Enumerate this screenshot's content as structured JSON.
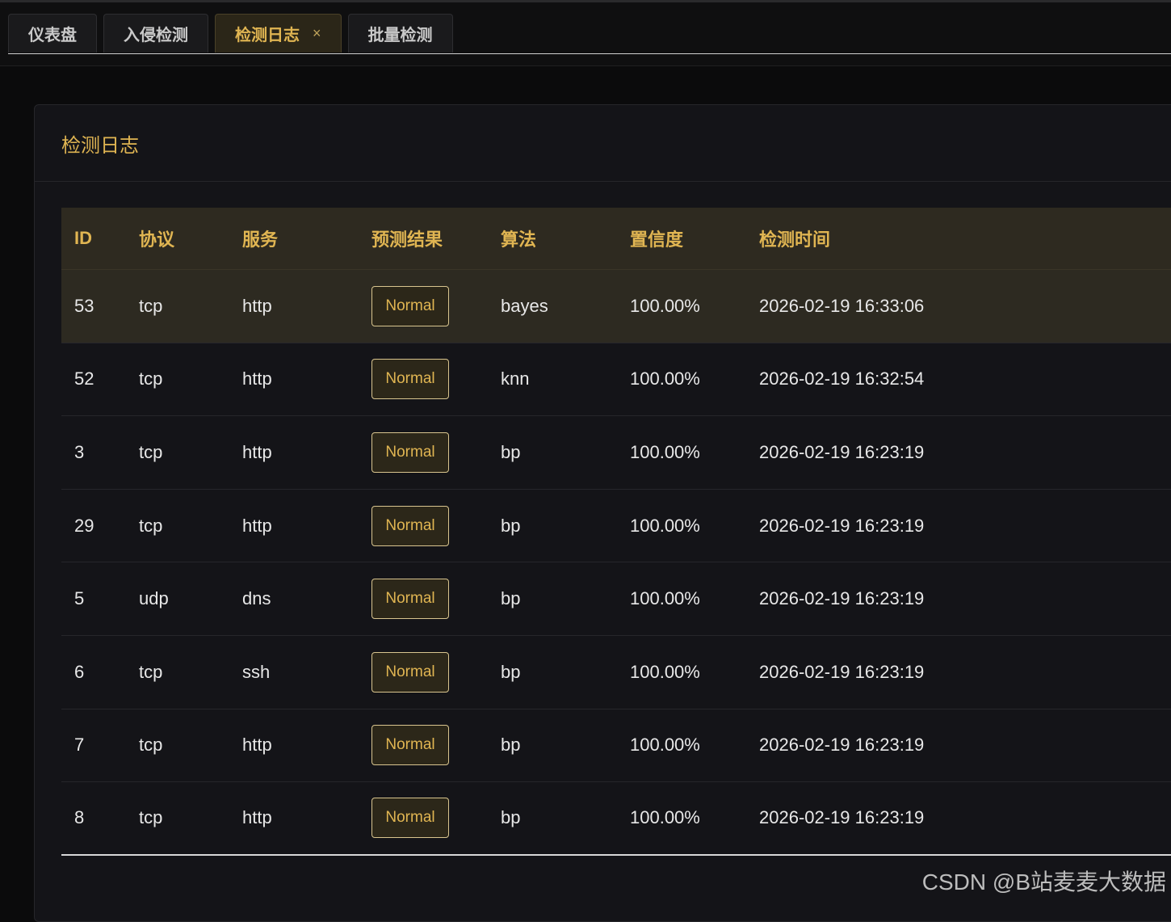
{
  "tabs": [
    {
      "label": "仪表盘",
      "active": false
    },
    {
      "label": "入侵检测",
      "active": false
    },
    {
      "label": "检测日志",
      "active": true,
      "close": "×"
    },
    {
      "label": "批量检测",
      "active": false
    }
  ],
  "card": {
    "title": "检测日志"
  },
  "table": {
    "columns": [
      "ID",
      "协议",
      "服务",
      "预测结果",
      "算法",
      "置信度",
      "检测时间"
    ],
    "rows": [
      [
        "53",
        "tcp",
        "http",
        "Normal",
        "bayes",
        "100.00%",
        "2026-02-19 16:33:06"
      ],
      [
        "52",
        "tcp",
        "http",
        "Normal",
        "knn",
        "100.00%",
        "2026-02-19 16:32:54"
      ],
      [
        "3",
        "tcp",
        "http",
        "Normal",
        "bp",
        "100.00%",
        "2026-02-19 16:23:19"
      ],
      [
        "29",
        "tcp",
        "http",
        "Normal",
        "bp",
        "100.00%",
        "2026-02-19 16:23:19"
      ],
      [
        "5",
        "udp",
        "dns",
        "Normal",
        "bp",
        "100.00%",
        "2026-02-19 16:23:19"
      ],
      [
        "6",
        "tcp",
        "ssh",
        "Normal",
        "bp",
        "100.00%",
        "2026-02-19 16:23:19"
      ],
      [
        "7",
        "tcp",
        "http",
        "Normal",
        "bp",
        "100.00%",
        "2026-02-19 16:23:19"
      ],
      [
        "8",
        "tcp",
        "http",
        "Normal",
        "bp",
        "100.00%",
        "2026-02-19 16:23:19"
      ]
    ]
  },
  "watermark": "CSDN @B站麦麦大数据",
  "colors": {
    "accent": "#e0b552",
    "background": "#0b0b0c",
    "card": "#141418"
  }
}
